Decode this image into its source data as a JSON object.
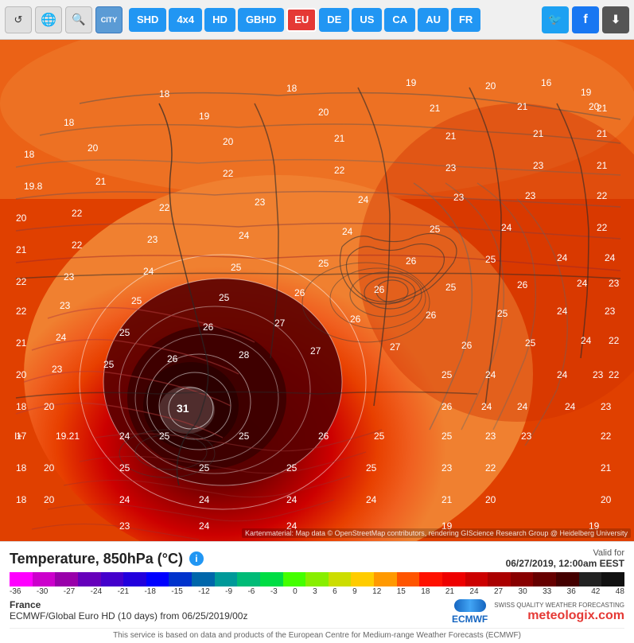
{
  "toolbar": {
    "refresh_label": "↺",
    "globe_label": "🌐",
    "search_label": "🔍",
    "city_label": "CITY",
    "buttons": [
      {
        "id": "shd",
        "label": "SHD",
        "color": "blue"
      },
      {
        "id": "4x4",
        "label": "4x4",
        "color": "blue"
      },
      {
        "id": "hd",
        "label": "HD",
        "color": "blue"
      },
      {
        "id": "gbhd",
        "label": "GBHD",
        "color": "blue"
      },
      {
        "id": "eu",
        "label": "EU",
        "color": "red",
        "active": true
      },
      {
        "id": "de",
        "label": "DE",
        "color": "blue"
      },
      {
        "id": "us",
        "label": "US",
        "color": "blue"
      },
      {
        "id": "ca",
        "label": "CA",
        "color": "blue"
      },
      {
        "id": "au",
        "label": "AU",
        "color": "blue"
      },
      {
        "id": "fr",
        "label": "FR",
        "color": "blue"
      }
    ],
    "social": [
      {
        "id": "twitter",
        "label": "🐦",
        "color": "twitter"
      },
      {
        "id": "facebook",
        "label": "f",
        "color": "facebook"
      },
      {
        "id": "download",
        "label": "⬇",
        "color": "download"
      }
    ]
  },
  "map": {
    "attribution": "Kartenmaterial: Map data © OpenStreetMap contributors, rendering GIScience Research Group @ Heidelberg University",
    "temperature_label": "31"
  },
  "legend": {
    "title": "Temperature, 850hPa (°C)",
    "info_label": "i",
    "valid_for_label": "Valid for",
    "valid_date": "06/27/2019, 12:00am EEST",
    "color_values": [
      "-36",
      "-30",
      "-27",
      "-24",
      "-21",
      "-18",
      "-15",
      "-12",
      "-9",
      "-6",
      "-3",
      "0",
      "3",
      "6",
      "9",
      "12",
      "15",
      "18",
      "21",
      "24",
      "27",
      "30",
      "33",
      "36",
      "42",
      "48"
    ],
    "color_stops": [
      "#FF00FF",
      "#E000E0",
      "#C000C0",
      "#A000A0",
      "#8000FF",
      "#6000E0",
      "#0000FF",
      "#0040C0",
      "#0080A0",
      "#00C0C0",
      "#00E0A0",
      "#00FF60",
      "#80FF00",
      "#C0E000",
      "#FFFF00",
      "#FFD000",
      "#FFA000",
      "#FF6000",
      "#FF2000",
      "#E00000",
      "#C00000",
      "#A00000",
      "#800000",
      "#600000",
      "#400000",
      "#303030",
      "#202020"
    ],
    "region": "France",
    "model": "ECMWF/Global Euro HD (10 days) from 06/25/2019/00z",
    "disclaimer": "This service is based on data and products of the European Centre for Medium-range Weather Forecasts (ECMWF)",
    "meteologix_tagline": "meteologix.com",
    "meteologix_sub": "SWISS QUALITY WEATHER FORECASTING",
    "ecmwf_label": "ECMWF"
  }
}
